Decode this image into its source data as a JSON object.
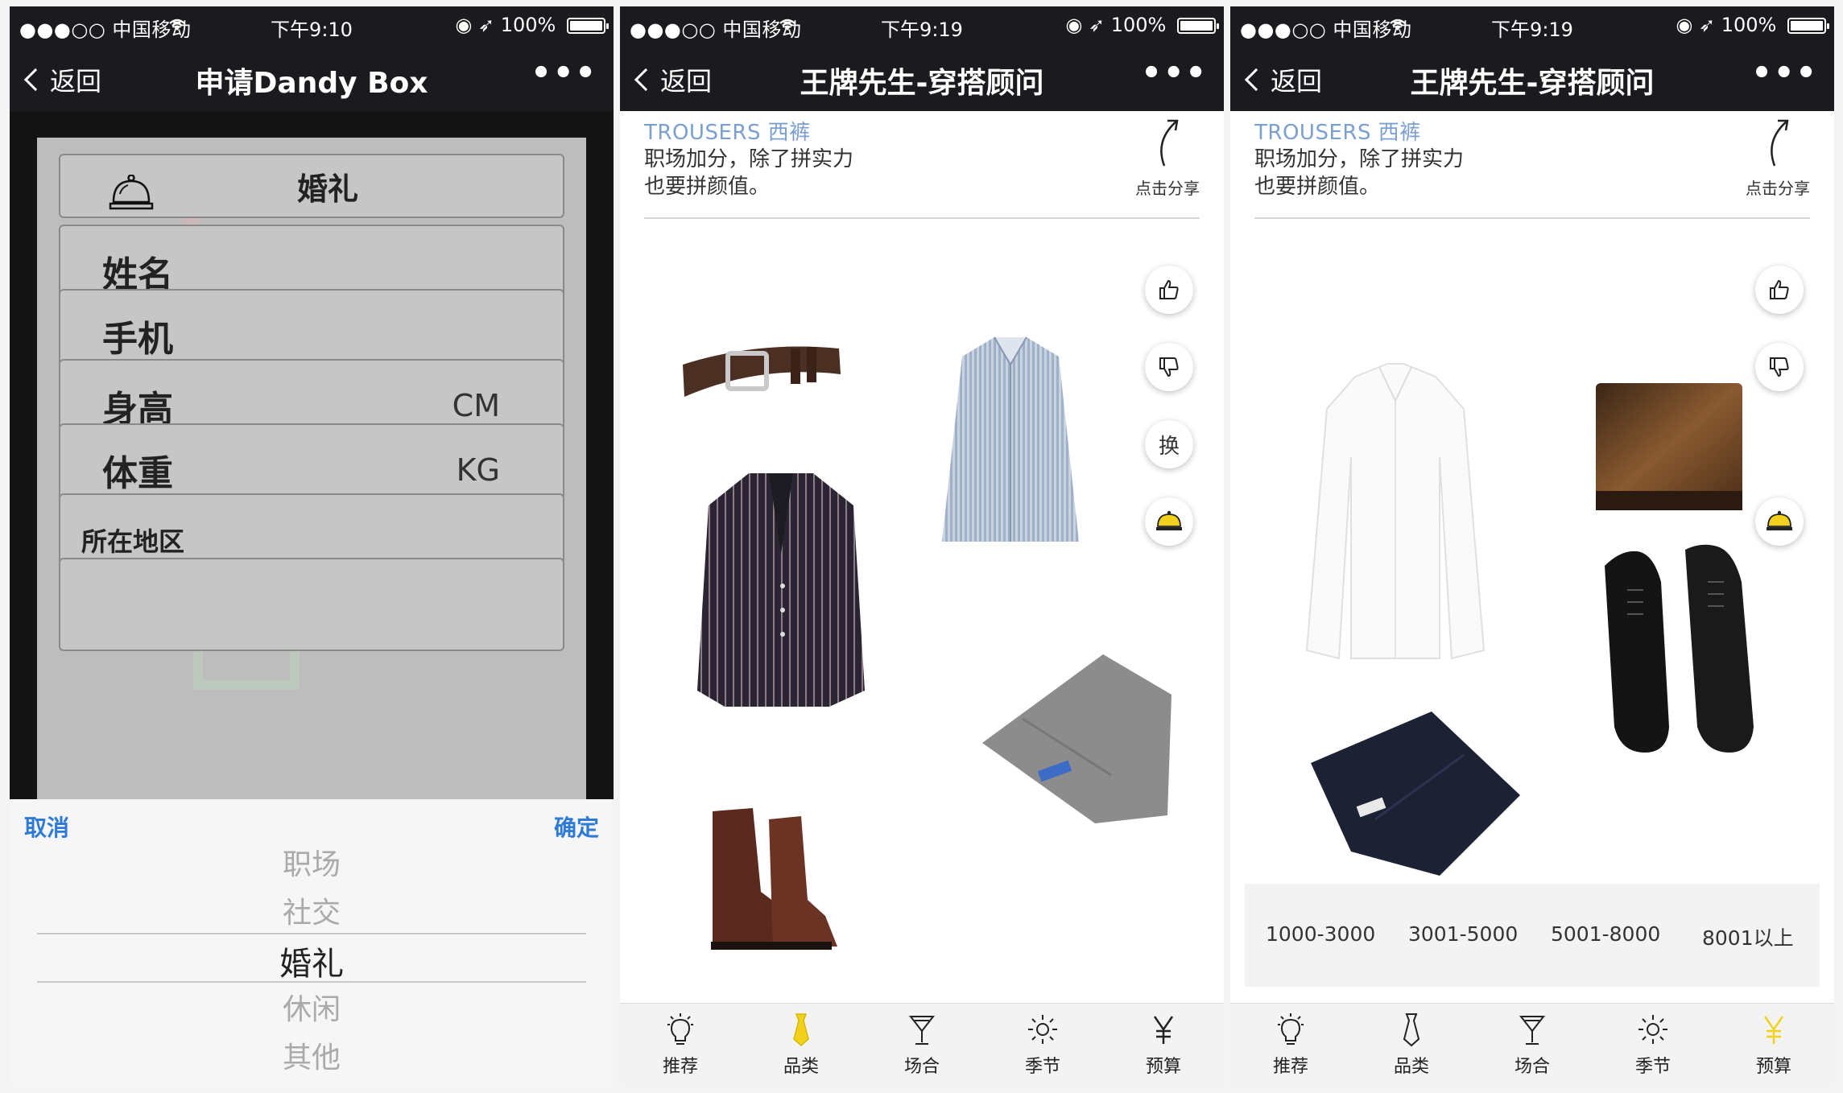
{
  "status": {
    "carrier": "●●●○○ 中国移动",
    "battery": "100%",
    "screen1_time": "下午9:10",
    "screen2_time": "下午9:19",
    "screen3_time": "下午9:19"
  },
  "nav": {
    "back_label": "返回",
    "screen1_title": "申请Dandy Box",
    "outfit_title": "王牌先生-穿搭顾问",
    "more": "•••"
  },
  "form": {
    "occasion_value": "婚礼",
    "fields": [
      {
        "label": "姓名",
        "unit": ""
      },
      {
        "label": "手机",
        "unit": ""
      },
      {
        "label": "身高",
        "unit": "CM"
      },
      {
        "label": "体重",
        "unit": "KG"
      },
      {
        "label": "所在地区",
        "unit": ""
      }
    ]
  },
  "picker": {
    "cancel": "取消",
    "confirm": "确定",
    "options": [
      "职场",
      "社交",
      "婚礼",
      "休闲",
      "其他"
    ],
    "selected": "婚礼"
  },
  "outfit_header": {
    "category": "TROUSERS 西裤",
    "line1": "职场加分，除了拼实力",
    "line2": "也要拼颜值。",
    "share_hint": "点击分享"
  },
  "actions": {
    "swap_label": "换"
  },
  "budget_options": [
    "1000-3000",
    "3001-5000",
    "5001-8000",
    "8001以上"
  ],
  "tabs": [
    {
      "label": "推荐",
      "icon": "bulb-icon"
    },
    {
      "label": "品类",
      "icon": "tie-icon"
    },
    {
      "label": "场合",
      "icon": "cocktail-icon"
    },
    {
      "label": "季节",
      "icon": "sun-icon"
    },
    {
      "label": "预算",
      "icon": "yen-icon"
    }
  ],
  "colors": {
    "nav_bg": "#1b1b1f",
    "link_blue": "#2e7bd6",
    "active_yellow": "#f2d11c",
    "category_blue": "#7b9fd1"
  }
}
